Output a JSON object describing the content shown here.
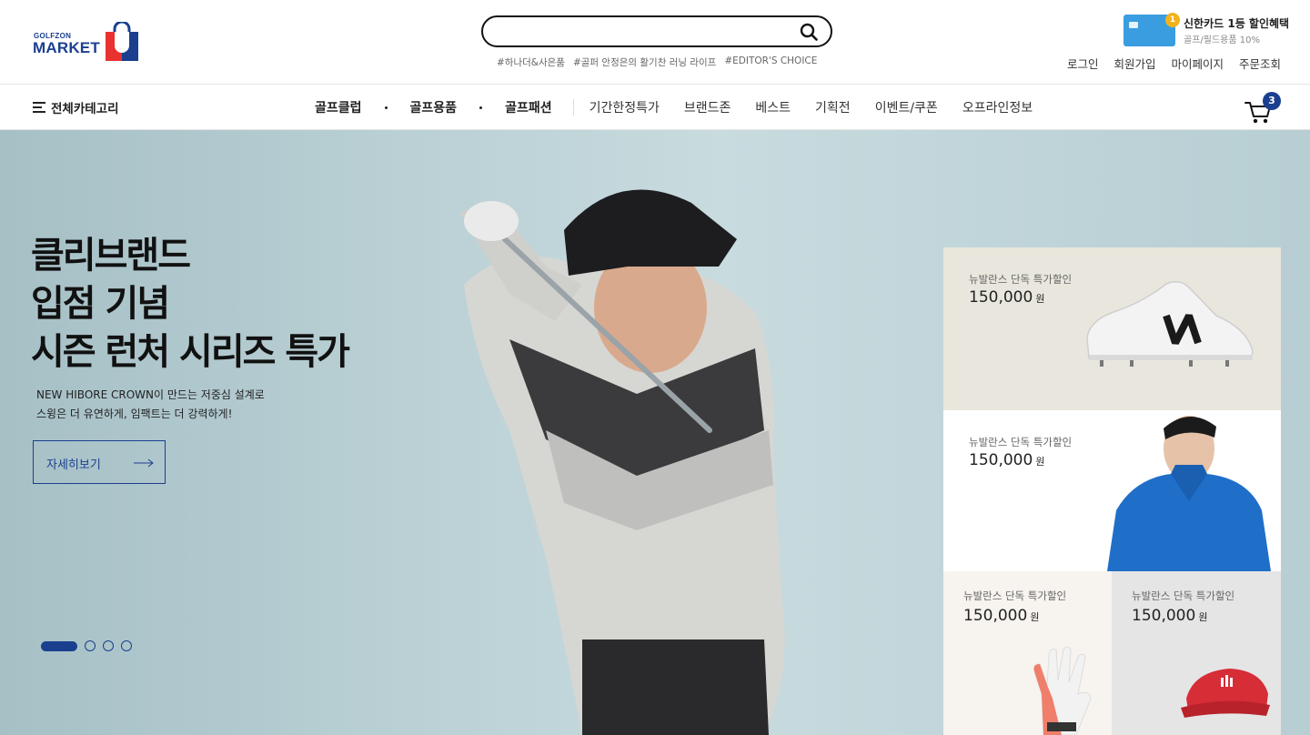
{
  "header": {
    "logo_small": "GOLFZON",
    "logo_big": "MARKET",
    "search": {
      "value": "",
      "placeholder": ""
    },
    "tags": [
      "#하나더&사은품",
      "#골퍼 안정은의 활기찬 러닝 라이프",
      "#EDITOR'S CHOICE"
    ],
    "promo": {
      "badge": "1",
      "title": "신한카드 1등 할인혜택",
      "subtitle": "골프/필드용품 10%"
    },
    "util_links": [
      "로그인",
      "회원가입",
      "마이페이지",
      "주문조회"
    ]
  },
  "nav": {
    "all_categories": "전체카테고리",
    "main_items": [
      "골프클럽",
      "골프용품",
      "골프패션"
    ],
    "sub_items": [
      "기간한정특가",
      "브랜드존",
      "베스트",
      "기획전",
      "이벤트/쿠폰",
      "오프라인정보"
    ],
    "cart_count": "3"
  },
  "hero": {
    "title_lines": [
      "클리브랜드",
      "입점 기념",
      "시즌 런처 시리즈 특가"
    ],
    "desc_lines": [
      "NEW HIBORE CROWN이 만드는 저중심 설계로",
      "스윙은 더 유연하게, 임팩트는 더 강력하게!"
    ],
    "button_label": "자세히보기",
    "slides_total": 4,
    "active_slide": 1
  },
  "products": [
    {
      "name": "뉴발란스 단독 특가할인",
      "price": "150,000",
      "unit": "원",
      "image": "white-cleat-shoe"
    },
    {
      "name": "뉴발란스 단독 특가할인",
      "price": "150,000",
      "unit": "원",
      "image": "blue-jacket-model"
    },
    {
      "name": "뉴발란스 단독 특가할인",
      "price": "150,000",
      "unit": "원",
      "image": "golf-glove"
    },
    {
      "name": "뉴발란스 단독 특가할인",
      "price": "150,000",
      "unit": "원",
      "image": "red-visor"
    }
  ],
  "colors": {
    "brand": "#1b3f8f",
    "hero_bg": "#bcd2d6",
    "card": "#3a9de0"
  }
}
